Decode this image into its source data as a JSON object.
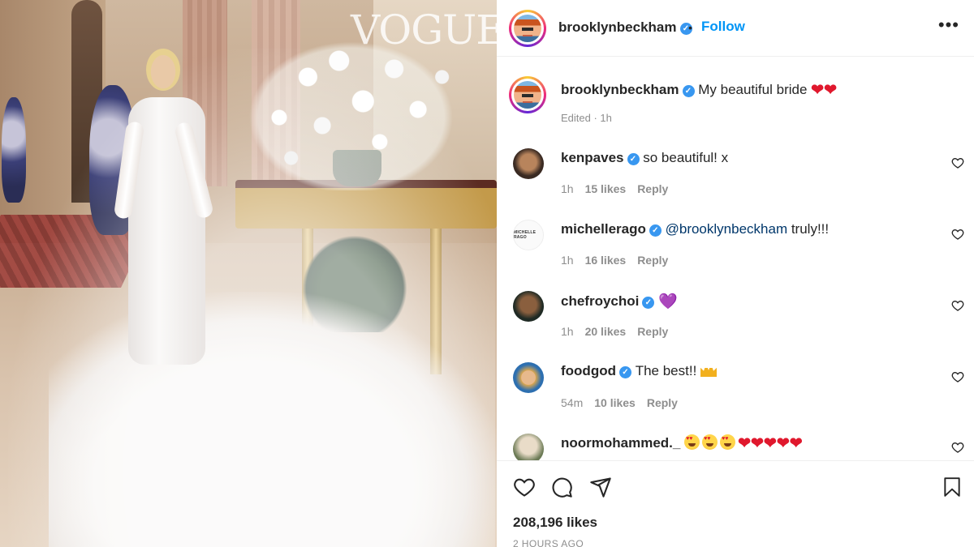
{
  "photo": {
    "watermark": "VOGUE"
  },
  "header": {
    "username": "brooklynbeckham",
    "follow_label": "Follow",
    "separator": "•"
  },
  "caption": {
    "username": "brooklynbeckham",
    "text": "My beautiful bride",
    "emoji": "❤❤",
    "edited": "Edited · 1h"
  },
  "comments": [
    {
      "username": "kenpaves",
      "text": "so beautiful! x",
      "time": "1h",
      "likes": "15 likes",
      "reply": "Reply"
    },
    {
      "username": "michellerago",
      "mention": "@brooklynbeckham",
      "text": " truly!!!",
      "time": "1h",
      "likes": "16 likes",
      "reply": "Reply"
    },
    {
      "username": "chefroychoi",
      "text": "💜",
      "time": "1h",
      "likes": "20 likes",
      "reply": "Reply"
    },
    {
      "username": "foodgod",
      "text": "The best!! ",
      "time": "54m",
      "likes": "10 likes",
      "reply": "Reply"
    },
    {
      "username": "noormohammed._",
      "text": "",
      "hearts": "❤❤❤❤❤"
    }
  ],
  "footer": {
    "likes": "208,196 likes",
    "ago": "2 HOURS AGO"
  },
  "colors": {
    "link_blue": "#0095f6",
    "verified_blue": "#3897f0",
    "muted": "#8e8e8e",
    "heart_red": "#e0182d"
  },
  "icons": [
    "more-icon",
    "verified-icon",
    "heart-icon",
    "comment-icon",
    "share-icon",
    "bookmark-icon"
  ]
}
